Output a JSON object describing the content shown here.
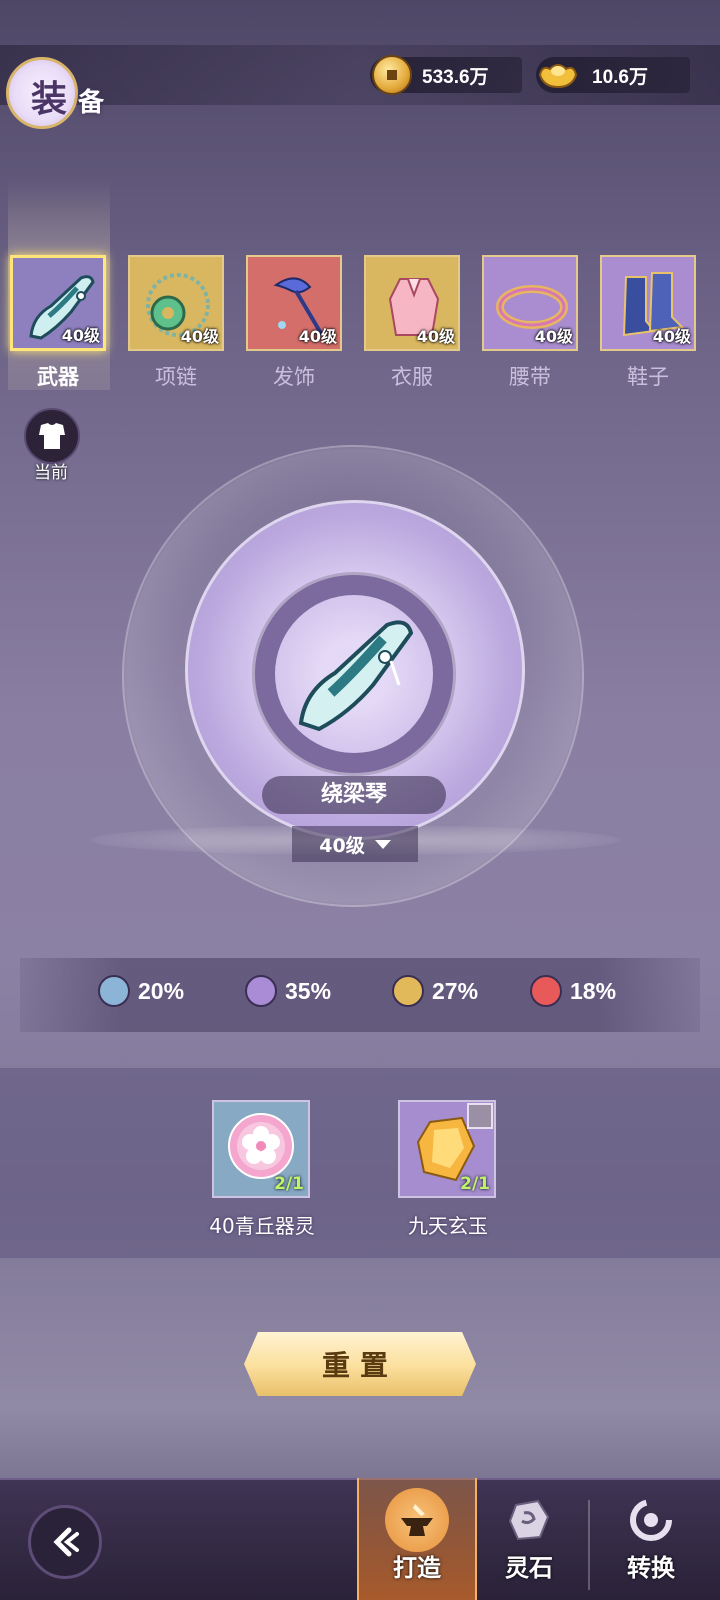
{
  "header": {
    "title_main": "装",
    "title_sub": "备",
    "coins": "533.6万",
    "ingots": "10.6万"
  },
  "tabs": [
    {
      "label": "武器",
      "level": "40级",
      "active": true,
      "icon": "guqin-weapon-icon",
      "bg": "#8e80bf"
    },
    {
      "label": "项链",
      "level": "40级",
      "active": false,
      "icon": "jade-necklace-icon",
      "bg": "#d9b760"
    },
    {
      "label": "发饰",
      "level": "40级",
      "active": false,
      "icon": "hairpin-icon",
      "bg": "#d46e6a"
    },
    {
      "label": "衣服",
      "level": "40级",
      "active": false,
      "icon": "pink-robe-icon",
      "bg": "#d9b760"
    },
    {
      "label": "腰带",
      "level": "40级",
      "active": false,
      "icon": "belt-ring-icon",
      "bg": "#a98dd0"
    },
    {
      "label": "鞋子",
      "level": "40级",
      "active": false,
      "icon": "boots-icon",
      "bg": "#a98dd0"
    }
  ],
  "current_label": "当前",
  "item": {
    "name": "绕梁琴",
    "level": "40级"
  },
  "percentages": [
    {
      "value": "20%",
      "color": "#8cb4d6"
    },
    {
      "value": "35%",
      "color": "#a98bd6"
    },
    {
      "value": "27%",
      "color": "#e2b95a"
    },
    {
      "value": "18%",
      "color": "#e85a5a"
    }
  ],
  "materials": [
    {
      "name": "40青丘器灵",
      "count": "2/1",
      "bg": "#87a9c4",
      "icon": "pink-flower-orb-icon"
    },
    {
      "name": "九天玄玉",
      "count": "2/1",
      "bg": "#a58dcf",
      "icon": "gold-crystal-icon"
    }
  ],
  "reset_label": "重置",
  "nav": {
    "forge": "打造",
    "spirit_stone": "灵石",
    "convert": "转换"
  }
}
